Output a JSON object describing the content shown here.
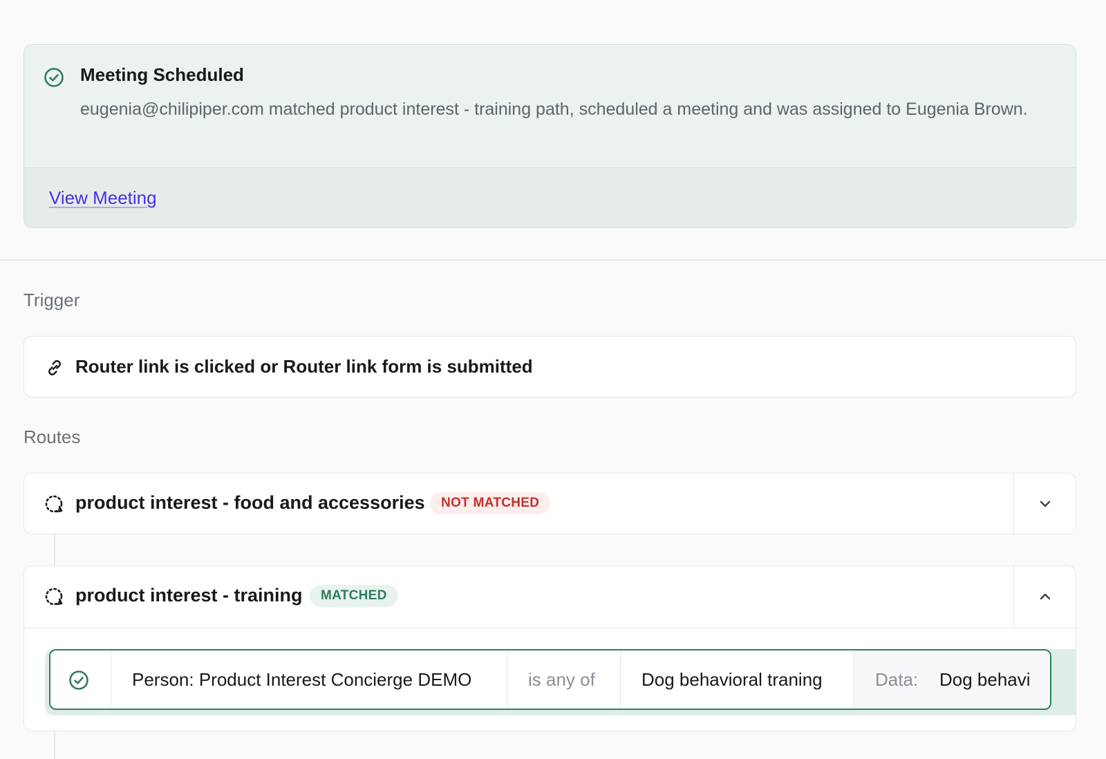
{
  "alert": {
    "title": "Meeting Scheduled",
    "description": "eugenia@chilipiper.com matched product interest - training path, scheduled a meeting and was assigned to Eugenia Brown.",
    "link_label": "View Meeting",
    "icon": "check-circle-icon"
  },
  "trigger": {
    "section_label": "Trigger",
    "text": "Router link is clicked or Router link form is submitted",
    "icon": "link-icon"
  },
  "routes": {
    "section_label": "Routes",
    "items": [
      {
        "name": "product interest - food and accessories",
        "status": "NOT MATCHED",
        "expanded": false
      },
      {
        "name": "product interest - training",
        "status": "MATCHED",
        "expanded": true
      }
    ]
  },
  "condition": {
    "field": "Person: Product Interest Concierge DEMO",
    "operator": "is any of",
    "value": "Dog behavioral traning",
    "data_label": "Data:",
    "data_value": "Dog behavi"
  },
  "colors": {
    "accent_link": "#4b2fe0",
    "matched_green": "#2f7d5b",
    "not_matched_red": "#c4302b"
  }
}
